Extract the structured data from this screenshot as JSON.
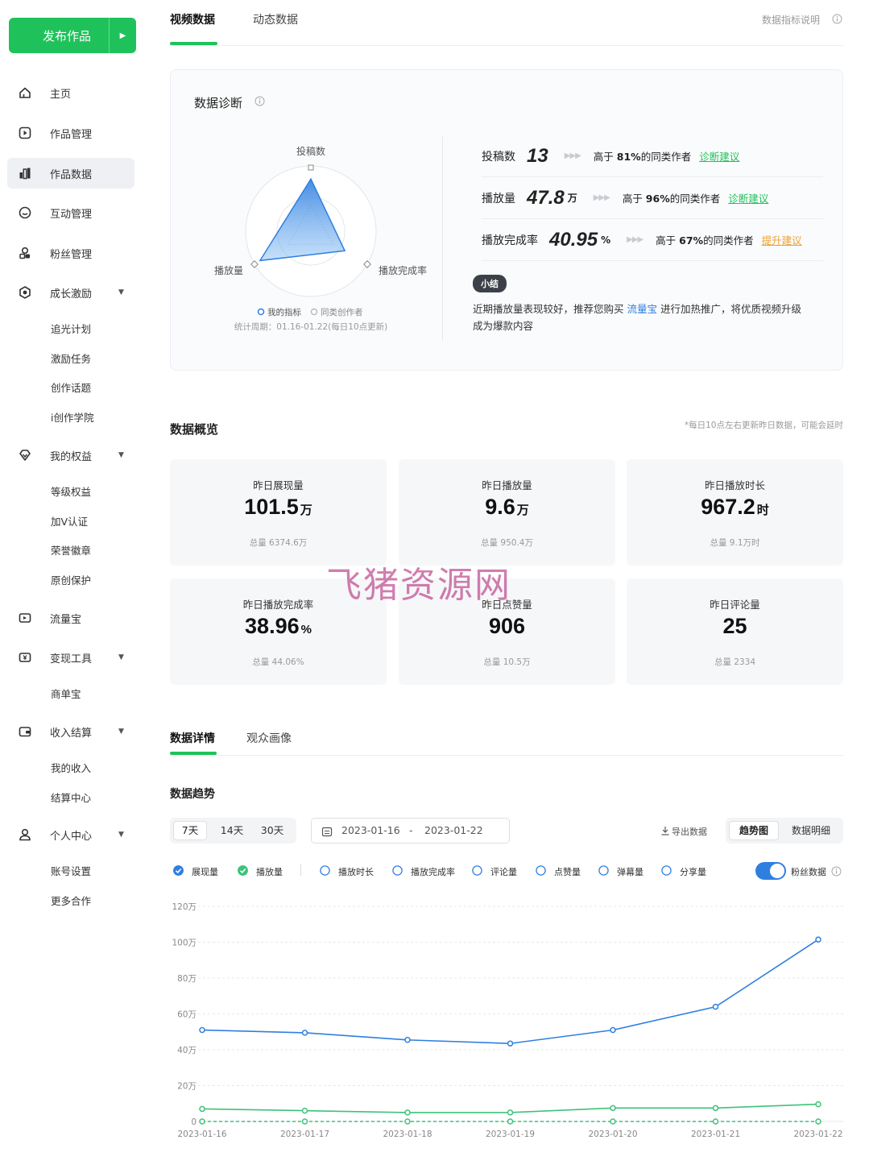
{
  "sidebar": {
    "publish_label": "发布作品",
    "nav": [
      {
        "label": "主页",
        "icon": "home-icon"
      },
      {
        "label": "作品管理",
        "icon": "play-square-icon"
      },
      {
        "label": "作品数据",
        "icon": "bar-chart-icon"
      },
      {
        "label": "互动管理",
        "icon": "chat-icon"
      },
      {
        "label": "粉丝管理",
        "icon": "fans-icon"
      },
      {
        "label": "成长激励",
        "icon": "medal-icon"
      },
      {
        "label": "我的权益",
        "icon": "diamond-icon"
      },
      {
        "label": "流量宝",
        "icon": "ticket-icon"
      },
      {
        "label": "变现工具",
        "icon": "yen-ticket-icon"
      },
      {
        "label": "收入结算",
        "icon": "wallet-icon"
      },
      {
        "label": "个人中心",
        "icon": "user-icon"
      }
    ],
    "growth_sub": [
      "追光计划",
      "激励任务",
      "创作话题",
      "i创作学院"
    ],
    "rights_sub": [
      "等级权益",
      "加V认证",
      "荣誉徽章",
      "原创保护"
    ],
    "monetize_sub": [
      "商单宝"
    ],
    "income_sub": [
      "我的收入",
      "结算中心"
    ],
    "personal_sub": [
      "账号设置",
      "更多合作"
    ]
  },
  "top_tabs": [
    "视频数据",
    "动态数据"
  ],
  "metrics_help": "数据指标说明",
  "diagnosis": {
    "title": "数据诊断",
    "radar_labels": [
      "投稿数",
      "播放量",
      "播放完成率"
    ],
    "legend": [
      "我的指标",
      "同类创作者"
    ],
    "period": "统计周期：01.16-01.22(每日10点更新)",
    "my_values": [
      0.8,
      0.9,
      0.6
    ],
    "peer_values": [
      0.4,
      0.4,
      0.4
    ],
    "rows": [
      {
        "label": "投稿数",
        "value": "13",
        "unit": "",
        "prefix": "高于 ",
        "pct": "81%",
        "suffix": "的同类作者",
        "link": "诊断建议",
        "link_color": "#1fc25a"
      },
      {
        "label": "播放量",
        "value": "47.8",
        "unit": "万",
        "prefix": "高于 ",
        "pct": "96%",
        "suffix": "的同类作者",
        "link": "诊断建议",
        "link_color": "#1fc25a"
      },
      {
        "label": "播放完成率",
        "value": "40.95",
        "unit": "%",
        "prefix": "高于 ",
        "pct": "67%",
        "suffix": "的同类作者",
        "link": "提升建议",
        "link_color": "#f0a030"
      }
    ],
    "summary_badge": "小结",
    "summary_pre": "近期播放量表现较好，推荐您购买 ",
    "summary_link": "流量宝",
    "summary_post": " 进行加热推广，将优质视频升级",
    "summary_line2": "成为爆款内容"
  },
  "overview": {
    "title": "数据概览",
    "note": "*每日10点左右更新昨日数据，可能会延时",
    "boxes": [
      {
        "title": "昨日展现量",
        "value": "101.5",
        "unit": "万",
        "sub": "总量 6374.6万"
      },
      {
        "title": "昨日播放量",
        "value": "9.6",
        "unit": "万",
        "sub": "总量 950.4万"
      },
      {
        "title": "昨日播放时长",
        "value": "967.2",
        "unit": "时",
        "sub": "总量 9.1万时"
      },
      {
        "title": "昨日播放完成率",
        "value": "38.96",
        "unit": "%",
        "sub": "总量 44.06%"
      },
      {
        "title": "昨日点赞量",
        "value": "906",
        "unit": "",
        "sub": "总量 10.5万"
      },
      {
        "title": "昨日评论量",
        "value": "25",
        "unit": "",
        "sub": "总量 2334"
      }
    ]
  },
  "watermark": "飞猪资源网",
  "details": {
    "tabs": [
      "数据详情",
      "观众画像"
    ],
    "trend_title": "数据趋势",
    "ranges": [
      "7天",
      "14天",
      "30天"
    ],
    "date_start": "2023-01-16",
    "date_sep": "-",
    "date_end": "2023-01-22",
    "export": "导出数据",
    "views": [
      "趋势图",
      "数据明细"
    ],
    "metrics": [
      {
        "label": "展现量",
        "checked": true,
        "color": "#2f7fe0"
      },
      {
        "label": "播放量",
        "checked": true,
        "color": "#3ec27a"
      },
      {
        "label": "播放时长",
        "checked": false
      },
      {
        "label": "播放完成率",
        "checked": false
      },
      {
        "label": "评论量",
        "checked": false
      },
      {
        "label": "点赞量",
        "checked": false
      },
      {
        "label": "弹幕量",
        "checked": false
      },
      {
        "label": "分享量",
        "checked": false
      }
    ],
    "fans_toggle": "粉丝数据"
  },
  "chart_data": {
    "type": "line",
    "x": [
      "2023-01-16",
      "2023-01-17",
      "2023-01-18",
      "2023-01-19",
      "2023-01-20",
      "2023-01-21",
      "2023-01-22"
    ],
    "y_ticks": [
      "0",
      "20万",
      "40万",
      "60万",
      "80万",
      "100万",
      "120万"
    ],
    "ylim": [
      0,
      120
    ],
    "grid": true,
    "series": [
      {
        "values": [
          51,
          49.5,
          45.5,
          43.5,
          51,
          64,
          101.5
        ],
        "color": "#2f7fe0",
        "dashed": false
      },
      {
        "values": [
          7,
          6,
          5,
          5,
          7.5,
          7.5,
          9.6
        ],
        "color": "#3ec27a",
        "dashed": false
      },
      {
        "values": [
          0,
          0,
          0,
          0,
          0,
          0,
          0
        ],
        "color": "#3ec27a",
        "dashed": true
      }
    ]
  }
}
